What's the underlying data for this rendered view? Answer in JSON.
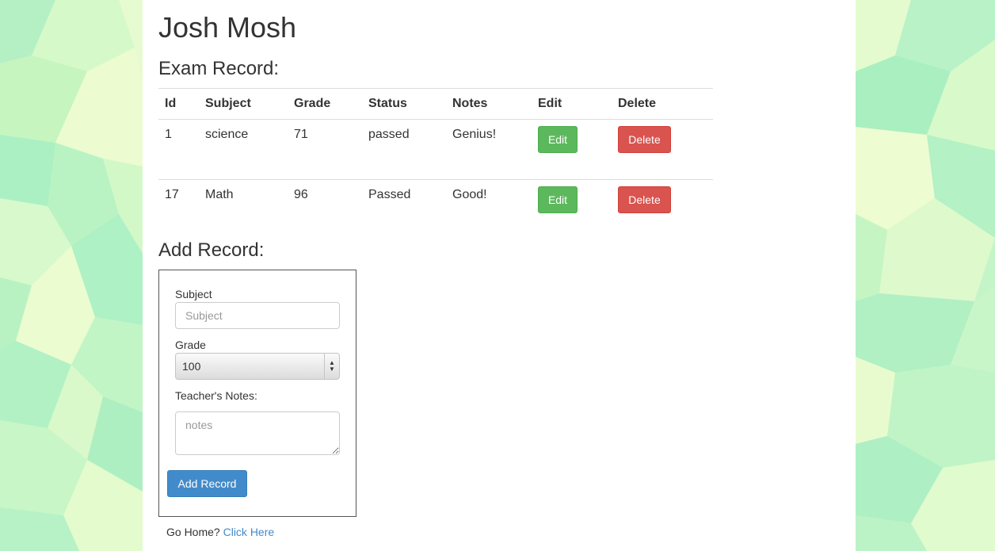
{
  "student": {
    "name": "Josh Mosh"
  },
  "exam_record": {
    "heading": "Exam Record:",
    "columns": [
      "Id",
      "Subject",
      "Grade",
      "Status",
      "Notes",
      "Edit",
      "Delete"
    ],
    "rows": [
      {
        "id": "1",
        "subject": "science",
        "grade": "71",
        "status": "passed",
        "notes": "Genius!",
        "edit_label": "Edit",
        "delete_label": "Delete"
      },
      {
        "id": "17",
        "subject": "Math",
        "grade": "96",
        "status": "Passed",
        "notes": "Good!",
        "edit_label": "Edit",
        "delete_label": "Delete"
      }
    ]
  },
  "add_record": {
    "heading": "Add Record:",
    "subject_label": "Subject",
    "subject_placeholder": "Subject",
    "subject_value": "",
    "grade_label": "Grade",
    "grade_selected": "100",
    "notes_label": "Teacher's Notes:",
    "notes_placeholder": "notes",
    "submit_label": "Add Record"
  },
  "footer": {
    "prompt": "Go Home?",
    "link_label": "Click Here"
  },
  "colors": {
    "success": "#5cb85c",
    "danger": "#d9534f",
    "primary": "#428bca",
    "link": "#428bca",
    "background": "#c9f5c4"
  },
  "icons": [
    "select-arrows-icon"
  ]
}
